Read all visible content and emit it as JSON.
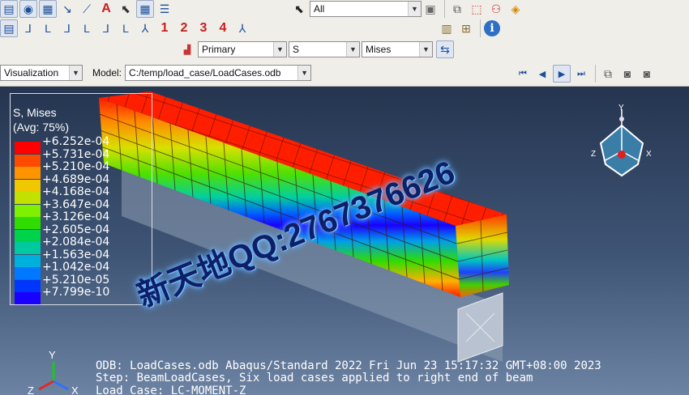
{
  "toolbar": {
    "row1_icons": [
      "open-icon",
      "print-icon",
      "palette-icon",
      "query-icon",
      "arrow-tool-icon",
      "text-tool-icon",
      "select-icon",
      "table-icon",
      "list-icon"
    ],
    "selection_filter": "All",
    "render_style_icons": [
      "wireframe-icon",
      "hidden-icon",
      "shaded-icon",
      "perspective-icon"
    ]
  },
  "csys_toolbar": {
    "icons": [
      "csys-xy-icon",
      "csys-xz-icon",
      "csys-zy-icon",
      "csys-yx-icon",
      "csys-zx-icon",
      "csys-yz-icon",
      "csys-iso-icon"
    ],
    "numbers": [
      "1",
      "2",
      "3",
      "4"
    ]
  },
  "field_output": {
    "variable_position": "Primary",
    "variable": "S",
    "component": "Mises"
  },
  "context": {
    "module_label": "Visualization",
    "model_label": "Model:",
    "model_path": "C:/temp/load_case/LoadCases.odb"
  },
  "legend": {
    "title": "S, Mises",
    "subtitle": "(Avg: 75%)",
    "ticks": [
      "+6.252e-04",
      "+5.731e-04",
      "+5.210e-04",
      "+4.689e-04",
      "+4.168e-04",
      "+3.647e-04",
      "+3.126e-04",
      "+2.605e-04",
      "+2.084e-04",
      "+1.563e-04",
      "+1.042e-04",
      "+5.210e-05",
      "+7.799e-10"
    ],
    "colors": [
      "#ff0000",
      "#ff4a00",
      "#ff9400",
      "#f0c800",
      "#c3e100",
      "#7ff000",
      "#30dc00",
      "#00d24b",
      "#00c8a0",
      "#00b0dc",
      "#0078ff",
      "#0037ff",
      "#1a00ff"
    ]
  },
  "watermark": "新天地QQ:2767376626",
  "triad": {
    "y": "Y",
    "z": "Z",
    "x": "X"
  },
  "info": {
    "odb_line": "ODB: LoadCases.odb    Abaqus/Standard 2022    Fri Jun 23 15:17:32 GMT+08:00 2023",
    "step_line": "Step: BeamLoadCases, Six load cases applied to right end of beam",
    "loadcase_line": "Load Case: LC-MOMENT-Z"
  }
}
